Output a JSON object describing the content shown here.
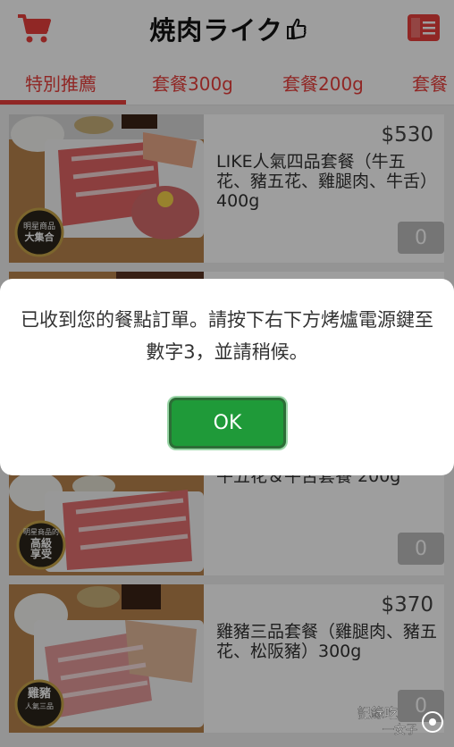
{
  "header": {
    "brand": "焼肉ライク",
    "cart_icon": "cart-icon",
    "menu_icon": "menu-icon",
    "accent_color": "#e8403c"
  },
  "tabs": [
    {
      "label": "特別推薦",
      "selected": true
    },
    {
      "label": "套餐300g",
      "selected": false
    },
    {
      "label": "套餐200g",
      "selected": false
    },
    {
      "label": "套餐",
      "selected": false
    }
  ],
  "items": [
    {
      "price": "$530",
      "name": "LIKE人氣四品套餐（牛五花、豬五花、雞腿肉、牛舌）400g",
      "quantity": "0",
      "photo_badge": [
        "明星商品",
        "大集合"
      ]
    },
    {
      "price": "",
      "name": "",
      "quantity": "",
      "photo_badge": []
    },
    {
      "price": "",
      "name": "牛五花＆牛舌套餐 200g",
      "quantity": "0",
      "photo_badge": [
        "明星商品的",
        "高級",
        "享受"
      ]
    },
    {
      "price": "$370",
      "name": "雞豬三品套餐（雞腿肉、豬五花、松阪豬）300g",
      "quantity": "0",
      "photo_badge": [
        "雞豬",
        "人氣三品"
      ]
    }
  ],
  "dialog": {
    "message": "已收到您的餐點訂單。請按下右下方烤爐電源鍵至數字3，並請稍候。",
    "ok_label": "OK"
  },
  "watermark": "記錄吃一女子"
}
